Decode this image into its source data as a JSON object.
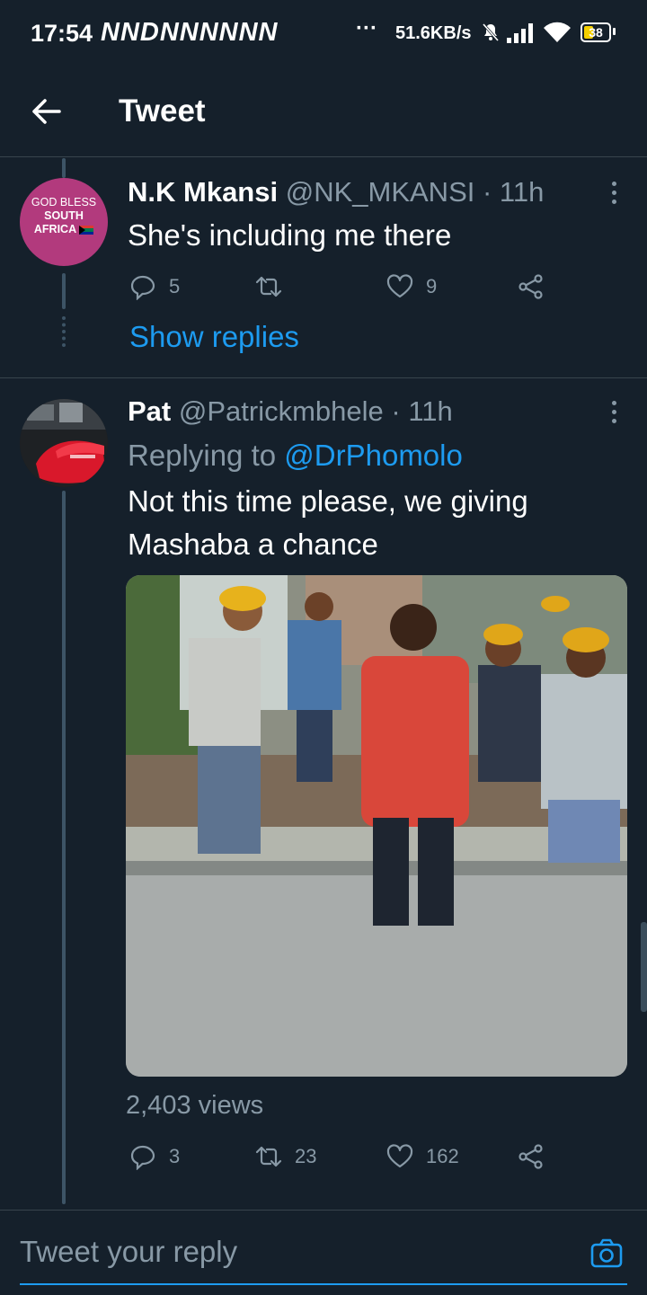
{
  "status_bar": {
    "time": "17:54",
    "notification_icons": "NNDNNNNNN",
    "overflow": "···",
    "network_speed": "51.6KB/s",
    "battery": "38"
  },
  "header": {
    "title": "Tweet",
    "back_icon": "arrow-left-icon"
  },
  "tweets": [
    {
      "avatar_text": [
        "GOD BLESS",
        "SOUTH",
        "AFRICA"
      ],
      "display_name": "N.K Mkansi",
      "handle": "@NK_MKANSI",
      "time": "· 11h",
      "text": "She's including me there",
      "reply_count": "5",
      "retweet_count": "",
      "like_count": "9",
      "show_replies": "Show replies"
    },
    {
      "display_name": "Pat",
      "handle": "@Patrickmbhele",
      "time": "· 11h",
      "replying_prefix": "Replying to",
      "replying_to": "@DrPhomolo",
      "text_line1": "Not this time please, we giving",
      "text_line2": "Mashaba a chance",
      "views": "2,403 views",
      "reply_count": "3",
      "retweet_count": "23",
      "like_count": "162"
    }
  ],
  "reply_bar": {
    "placeholder": "Tweet your reply"
  },
  "colors": {
    "background": "#15202b",
    "accent": "#1d9bf0",
    "muted": "#8899a6",
    "divider": "#38444d"
  }
}
